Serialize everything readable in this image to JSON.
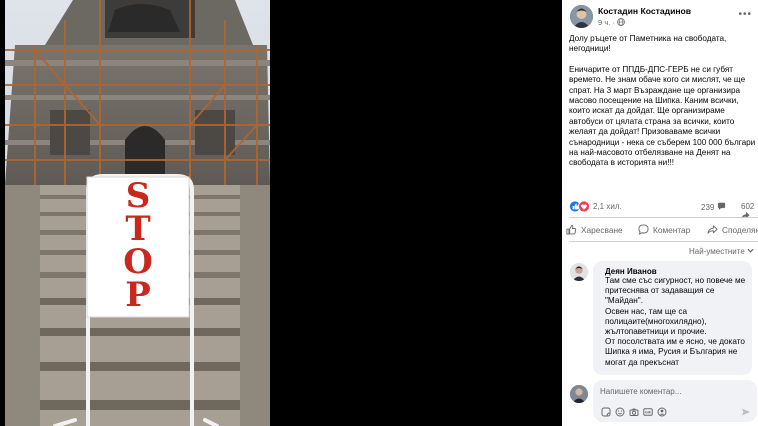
{
  "photo": {
    "sign_text": "STOP"
  },
  "post": {
    "author": "Костадин Костадинов",
    "time": "9 ч.",
    "more_label": "•••",
    "paragraphs": [
      "Долу ръцете от Паметника на свободата, негодници!",
      "Еничарите от ППДБ-ДПС-ГЕРБ не си губят времето. Не знам обаче кого си мислят, че ще спрат. На 3 март Възраждане ще организира масово посещение на Шипка. Каним всички, които искат да дойдат. Ще организираме автобуси от цялата страна за всички, които желаят да дойдат! Призоваваме всички сънародници - нека се съберем 100 000 българи на най-масовото отбелязване на Денят на свободата в историята ни!!!"
    ],
    "reactions_count": "2,1 хил.",
    "comments_count": "239",
    "shares_count": "602",
    "actions": {
      "like": "Харесване",
      "comment": "Коментар",
      "share": "Споделяне"
    },
    "sort_label": "Най-уместните"
  },
  "comment": {
    "author": "Деян Иванов",
    "lines": [
      "Там сме със сигурност, но повече ме притеснява от задаващия се \"Майдан\".",
      "Освен нас, там ще са полицаите(многохилядно), жълтопаветници и прочие.",
      "От посолствата им е ясно, че докато Шипка я има, Русия и България не могат да прекъснат"
    ]
  },
  "composer": {
    "placeholder": "Напишете коментар..."
  },
  "colors": {
    "stop_red": "#c8281e",
    "reaction_blue": "#1877f2",
    "reaction_red": "#f33e58"
  }
}
